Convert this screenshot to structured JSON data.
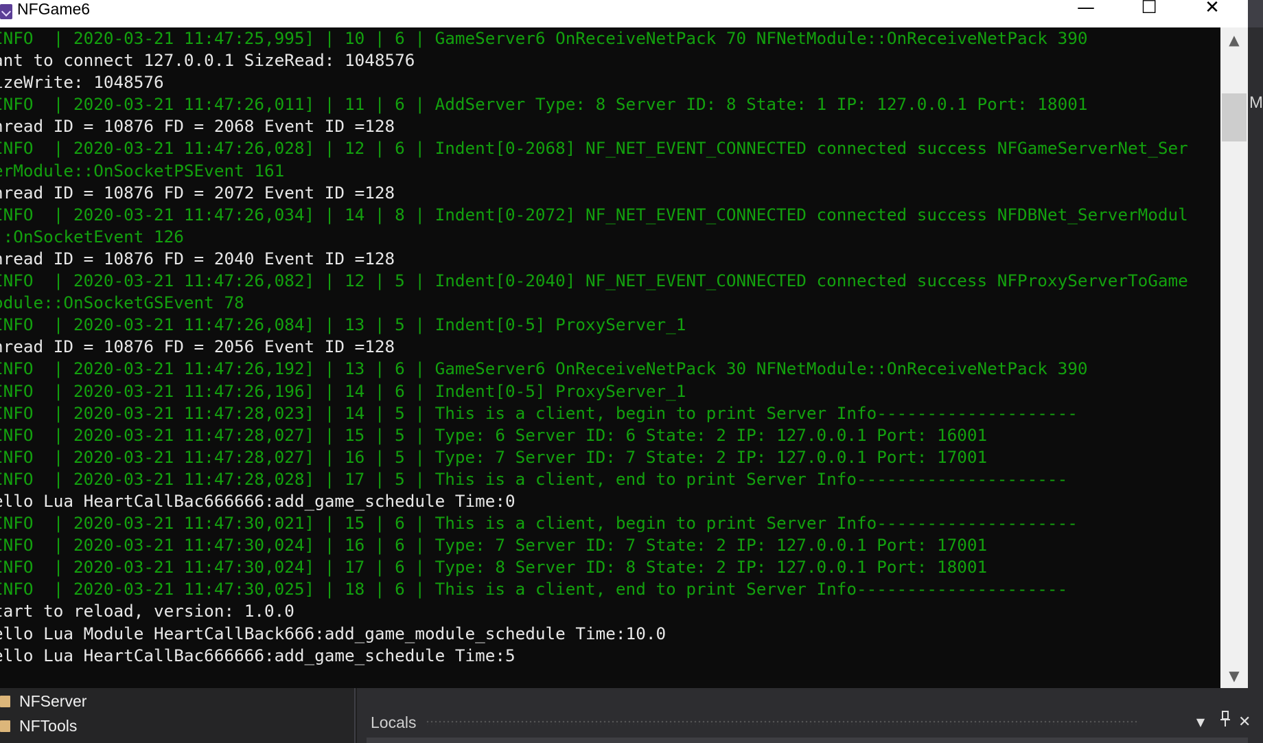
{
  "window": {
    "title": "NFGame6",
    "buttons": {
      "minimize": "—",
      "maximize": "☐",
      "close": "✕"
    }
  },
  "console": {
    "lines": [
      {
        "type": "info",
        "text": "INFO  | 2020-03-21 11:47:25,995] | 10 | 6 | GameServer6 OnReceiveNetPack 70 NFNetModule::OnReceiveNetPack 390"
      },
      {
        "type": "plain",
        "text": "ant to connect 127.0.0.1 SizeRead: 1048576"
      },
      {
        "type": "plain",
        "text": "izeWrite: 1048576"
      },
      {
        "type": "info",
        "text": "INFO  | 2020-03-21 11:47:26,011] | 11 | 6 | AddServer Type: 8 Server ID: 8 State: 1 IP: 127.0.0.1 Port: 18001"
      },
      {
        "type": "plain",
        "text": "hread ID = 10876 FD = 2068 Event ID =128"
      },
      {
        "type": "info",
        "text": "INFO  | 2020-03-21 11:47:26,028] | 12 | 6 | Indent[0-2068] NF_NET_EVENT_CONNECTED connected success NFGameServerNet_Ser"
      },
      {
        "type": "info",
        "text": "erModule::OnSocketPSEvent 161"
      },
      {
        "type": "plain",
        "text": "hread ID = 10876 FD = 2072 Event ID =128"
      },
      {
        "type": "info",
        "text": "INFO  | 2020-03-21 11:47:26,034] | 14 | 8 | Indent[0-2072] NF_NET_EVENT_CONNECTED connected success NFDBNet_ServerModul"
      },
      {
        "type": "info",
        "text": "::OnSocketEvent 126"
      },
      {
        "type": "plain",
        "text": "hread ID = 10876 FD = 2040 Event ID =128"
      },
      {
        "type": "info",
        "text": "INFO  | 2020-03-21 11:47:26,082] | 12 | 5 | Indent[0-2040] NF_NET_EVENT_CONNECTED connected success NFProxyServerToGame"
      },
      {
        "type": "info",
        "text": "odule::OnSocketGSEvent 78"
      },
      {
        "type": "info",
        "text": "INFO  | 2020-03-21 11:47:26,084] | 13 | 5 | Indent[0-5] ProxyServer_1"
      },
      {
        "type": "plain",
        "text": "hread ID = 10876 FD = 2056 Event ID =128"
      },
      {
        "type": "info",
        "text": "INFO  | 2020-03-21 11:47:26,192] | 13 | 6 | GameServer6 OnReceiveNetPack 30 NFNetModule::OnReceiveNetPack 390"
      },
      {
        "type": "info",
        "text": "INFO  | 2020-03-21 11:47:26,196] | 14 | 6 | Indent[0-5] ProxyServer_1"
      },
      {
        "type": "info",
        "text": "INFO  | 2020-03-21 11:47:28,023] | 14 | 5 | This is a client, begin to print Server Info--------------------"
      },
      {
        "type": "info",
        "text": "INFO  | 2020-03-21 11:47:28,027] | 15 | 5 | Type: 6 Server ID: 6 State: 2 IP: 127.0.0.1 Port: 16001"
      },
      {
        "type": "info",
        "text": "INFO  | 2020-03-21 11:47:28,027] | 16 | 5 | Type: 7 Server ID: 7 State: 2 IP: 127.0.0.1 Port: 17001"
      },
      {
        "type": "info",
        "text": "INFO  | 2020-03-21 11:47:28,028] | 17 | 5 | This is a client, end to print Server Info---------------------"
      },
      {
        "type": "plain",
        "text": "ello Lua HeartCallBac666666:add_game_schedule Time:0"
      },
      {
        "type": "info",
        "text": "INFO  | 2020-03-21 11:47:30,021] | 15 | 6 | This is a client, begin to print Server Info--------------------"
      },
      {
        "type": "info",
        "text": "INFO  | 2020-03-21 11:47:30,024] | 16 | 6 | Type: 7 Server ID: 7 State: 2 IP: 127.0.0.1 Port: 17001"
      },
      {
        "type": "info",
        "text": "INFO  | 2020-03-21 11:47:30,024] | 17 | 6 | Type: 8 Server ID: 8 State: 2 IP: 127.0.0.1 Port: 18001"
      },
      {
        "type": "info",
        "text": "INFO  | 2020-03-21 11:47:30,025] | 18 | 6 | This is a client, end to print Server Info---------------------"
      },
      {
        "type": "plain",
        "text": "tart to reload, version: 1.0.0"
      },
      {
        "type": "plain",
        "text": "ello Lua Module HeartCallBack666:add_game_module_schedule Time:10.0"
      },
      {
        "type": "plain",
        "text": "ello Lua HeartCallBac666666:add_game_schedule Time:5"
      }
    ],
    "colors": {
      "info": "#13a10e",
      "plain": "#e8e8e8",
      "background": "#0c0c0c"
    }
  },
  "scrollbar": {
    "up": "▲",
    "down": "▼"
  },
  "ide": {
    "edge_label": "Mo",
    "solution_explorer": {
      "items": [
        "NFServer",
        "NFTools"
      ]
    },
    "locals": {
      "title": "Locals",
      "dropdown": "▼",
      "pin": "📌",
      "close": "✕"
    }
  }
}
